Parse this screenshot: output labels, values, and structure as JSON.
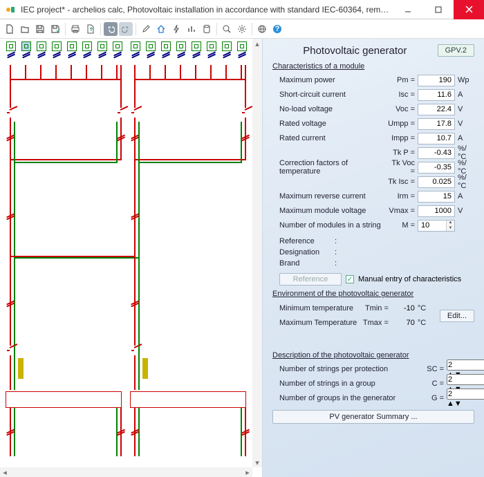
{
  "window": {
    "title": "IEC project* - archelios calc, Photovoltaic installation in accordance with standard IEC-60364, remai..."
  },
  "panel": {
    "title": "Photovoltaic generator",
    "tag": "GPV.2"
  },
  "section1": "Characteristics of a module",
  "char": {
    "pm_label": "Maximum power",
    "pm_sym": "Pm =",
    "pm_val": "190",
    "pm_unit": "Wp",
    "isc_label": "Short-circuit current",
    "isc_sym": "Isc =",
    "isc_val": "11.6",
    "isc_unit": "A",
    "voc_label": "No-load voltage",
    "voc_sym": "Voc =",
    "voc_val": "22.4",
    "voc_unit": "V",
    "umpp_label": "Rated voltage",
    "umpp_sym": "Umpp =",
    "umpp_val": "17.8",
    "umpp_unit": "V",
    "impp_label": "Rated current",
    "impp_sym": "Impp =",
    "impp_val": "10.7",
    "impp_unit": "A",
    "corr_label": "Correction factors of temperature",
    "tkp_sym": "Tk P =",
    "tkp_val": "-0.43",
    "tkp_unit": "%/°C",
    "tkvoc_sym": "Tk Voc =",
    "tkvoc_val": "-0.35",
    "tkvoc_unit": "%/°C",
    "tkisc_sym": "Tk Isc =",
    "tkisc_val": "0.025",
    "tkisc_unit": "%/°C",
    "irm_label": "Maximum reverse current",
    "irm_sym": "Irm =",
    "irm_val": "15",
    "irm_unit": "A",
    "vmax_label": "Maximum module voltage",
    "vmax_sym": "Vmax =",
    "vmax_val": "1000",
    "vmax_unit": "V",
    "m_label": "Number of modules in a string",
    "m_sym": "M =",
    "m_val": "10"
  },
  "meta": {
    "ref": "Reference",
    "des": "Designation",
    "brand": "Brand"
  },
  "ref_btn": "Reference",
  "manual_chk": "Manual entry of characteristics",
  "section2": "Environment of the photovoltaic generator",
  "env": {
    "tmin_label": "Minimum temperature",
    "tmin_sym": "Tmin =",
    "tmin_val": "-10",
    "tmin_unit": "°C",
    "tmax_label": "Maximum Temperature",
    "tmax_sym": "Tmax =",
    "tmax_val": "70",
    "tmax_unit": "°C",
    "edit": "Edit..."
  },
  "section3": "Description of the photovoltaic generator",
  "desc": {
    "sc_label": "Number of strings per protection",
    "sc_sym": "SC =",
    "sc_val": "2",
    "c_label": "Number of strings in a group",
    "c_sym": "C =",
    "c_val": "2",
    "g_label": "Number of groups in the generator",
    "g_sym": "G =",
    "g_val": "2"
  },
  "summary_btn": "PV generator Summary ..."
}
